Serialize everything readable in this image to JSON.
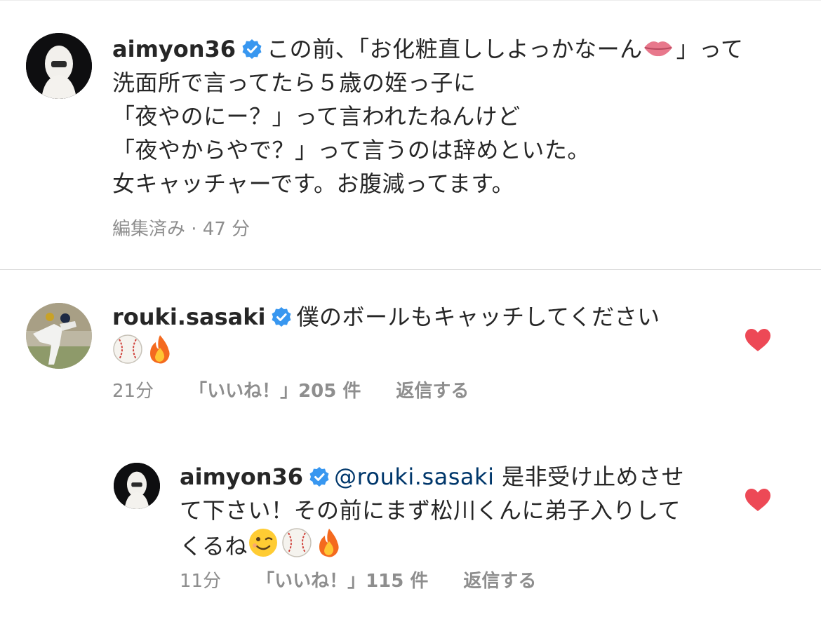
{
  "colors": {
    "text": "#262626",
    "meta": "#8e8e8e",
    "mention": "#00376b",
    "verified": "#3897f0",
    "heart": "#ed4956"
  },
  "caption": {
    "username": "aimyon36",
    "lines": [
      "この前、「お化粧直ししよっかなーん",
      "」って",
      "洗面所で言ってたら５歳の姪っ子に",
      "「夜やのにー？」って言われたねんけど",
      "「夜やからやで？」って言うのは辞めといた。",
      "女キャッチャーです。お腹減ってます。"
    ],
    "emoji": "lips-emoji",
    "edited": "編集済み · 47 分"
  },
  "comments": [
    {
      "username": "rouki.sasaki",
      "text": "僕のボールもキャッチしてください",
      "emojis": [
        "baseball-emoji",
        "fire-emoji"
      ],
      "time": "21分",
      "likes": "「いいね！」205 件",
      "reply": "返信する",
      "liked": true
    },
    {
      "username": "aimyon36",
      "mention": "@rouki.sasaki",
      "line1": "是非受け止めさせ",
      "line2": "て下さい！その前にまず松川くんに弟子入りして",
      "line3": "くるね",
      "emojis": [
        "winking-face-emoji",
        "baseball-emoji",
        "fire-emoji"
      ],
      "time": "11分",
      "likes": "「いいね！」115 件",
      "reply": "返信する",
      "liked": true
    }
  ]
}
